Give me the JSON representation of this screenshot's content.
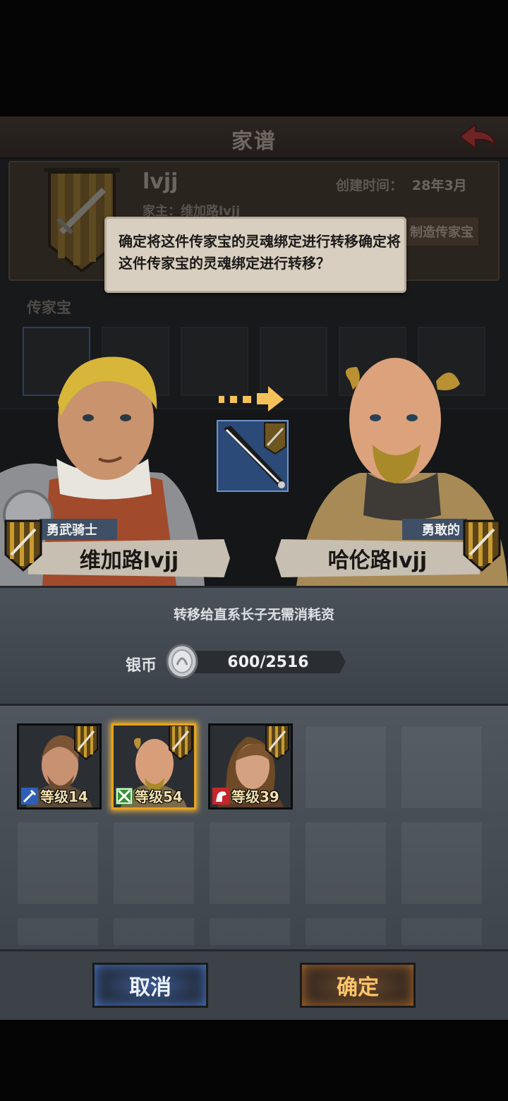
{
  "header": {
    "title": "家谱",
    "back_icon": "back-arrow-icon"
  },
  "family": {
    "name": "lvjj",
    "created_label": "创建时间：",
    "created_value": "28年3月",
    "head_line": "家主：维加路lvjj",
    "make_heirloom_label": "制造传家宝",
    "heirloom_section_label": "传家宝"
  },
  "dialog": {
    "message": "确定将这件传家宝的灵魂绑定进行转移确定将这件传家宝的灵魂绑定进行转移？"
  },
  "transfer": {
    "from": {
      "title": "勇武骑士",
      "name": "维加路lvjj"
    },
    "to": {
      "title": "勇敢的",
      "name": "哈伦路lvjj"
    }
  },
  "cost": {
    "note": "转移给直系长子无需消耗资",
    "currency_label": "银币",
    "amount": "600/2516",
    "coin_icon": "silver-coin-icon"
  },
  "heirs": [
    {
      "level": "等级14",
      "spec_icon": "sword-class-icon",
      "selected": false
    },
    {
      "level": "等级54",
      "spec_icon": "crossed-swords-class-icon",
      "selected": true
    },
    {
      "level": "等级39",
      "spec_icon": "horse-class-icon",
      "selected": false
    }
  ],
  "buttons": {
    "cancel": "取消",
    "confirm": "确定"
  },
  "colors": {
    "selected_border": "#e8a21c",
    "cancel_glow": "#4d7dd6",
    "confirm_text": "#ffc56a"
  }
}
